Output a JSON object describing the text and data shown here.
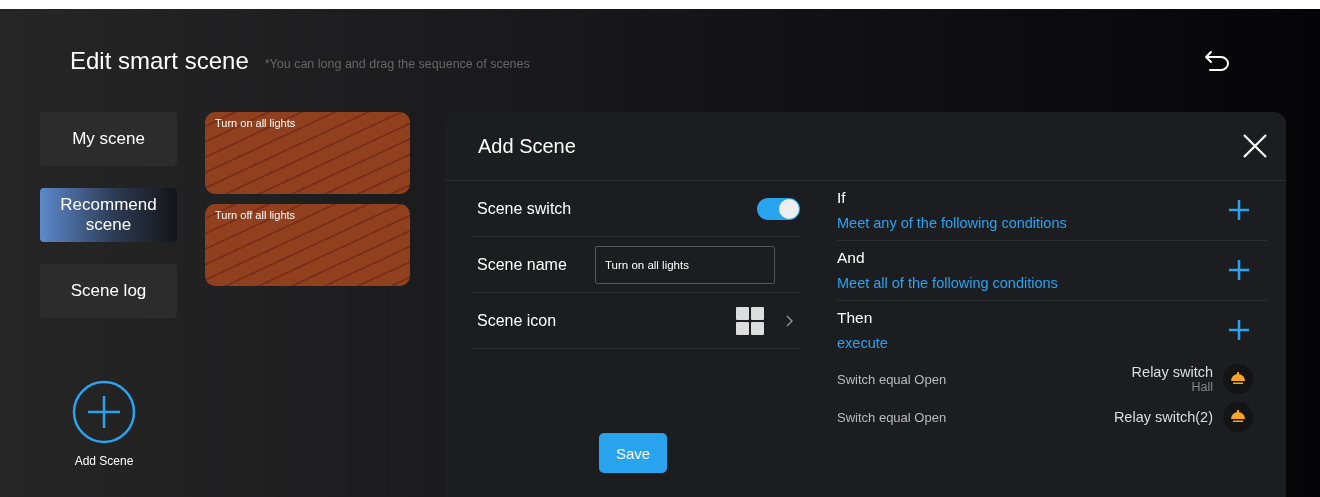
{
  "header": {
    "title": "Edit smart scene",
    "hint": "*You can long and drag the sequence of scenes"
  },
  "nav": [
    {
      "label": "My scene",
      "selected": false
    },
    {
      "label": "Recommend scene",
      "selected": true
    },
    {
      "label": "Scene log",
      "selected": false
    }
  ],
  "scene_cards": [
    {
      "title": "Turn on all lights"
    },
    {
      "title": "Turn off all lights"
    }
  ],
  "add_scene": {
    "label": "Add Scene"
  },
  "dialog": {
    "title": "Add Scene",
    "scene_switch": {
      "label": "Scene switch",
      "on": true
    },
    "scene_name": {
      "label": "Scene name",
      "value": "Turn on all lights"
    },
    "scene_icon": {
      "label": "Scene icon"
    },
    "save": "Save",
    "sections": [
      {
        "title": "If",
        "subtitle": "Meet any of the following conditions"
      },
      {
        "title": "And",
        "subtitle": "Meet all of the following conditions"
      },
      {
        "title": "Then",
        "subtitle": "execute"
      }
    ],
    "actions": [
      {
        "condition": "Switch equal Open",
        "device": "Relay switch",
        "room": "Hall"
      },
      {
        "condition": "Switch equal Open",
        "device": "Relay switch(2)"
      }
    ]
  }
}
